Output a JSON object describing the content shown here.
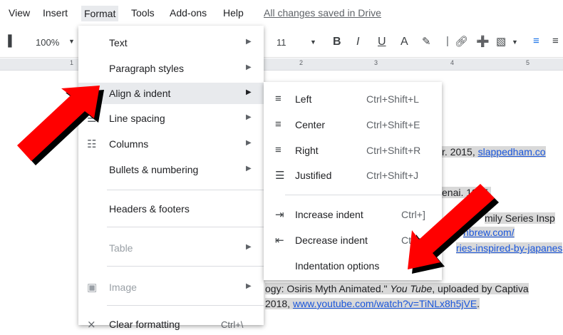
{
  "menubar": {
    "items": [
      "View",
      "Insert",
      "Format",
      "Tools",
      "Add-ons",
      "Help"
    ],
    "saved_status": "All changes saved in Drive"
  },
  "toolbar": {
    "zoom": "100%",
    "font_size": "11",
    "bold": "B",
    "italic": "I",
    "underline": "U",
    "text_color": "A"
  },
  "ruler": {
    "numbers": [
      "1",
      "2",
      "3",
      "4",
      "5"
    ]
  },
  "format_menu": {
    "items": [
      {
        "label": "Text"
      },
      {
        "label": "Paragraph styles"
      },
      {
        "label": "Align & indent"
      },
      {
        "label": "Line spacing"
      },
      {
        "label": "Columns"
      },
      {
        "label": "Bullets & numbering"
      },
      {
        "label": "Headers & footers"
      },
      {
        "label": "Table"
      },
      {
        "label": "Image"
      },
      {
        "label": "Clear formatting",
        "shortcut": "Ctrl+\\"
      }
    ]
  },
  "align_submenu": {
    "items": [
      {
        "label": "Left",
        "shortcut": "Ctrl+Shift+L"
      },
      {
        "label": "Center",
        "shortcut": "Ctrl+Shift+E"
      },
      {
        "label": "Right",
        "shortcut": "Ctrl+Shift+R"
      },
      {
        "label": "Justified",
        "shortcut": "Ctrl+Shift+J"
      },
      {
        "label": "Increase indent",
        "shortcut": "Ctrl+]"
      },
      {
        "label": "Decrease indent",
        "shortcut": "Ctrl+["
      },
      {
        "label": "Indentation options"
      }
    ]
  },
  "document": {
    "line1_text": "r. 2015, ",
    "line1_link": "slappedham.co",
    "line2_text": "enai. 1995.",
    "line3_text": "mily Series Insp",
    "line4_link": "nbrew.com/",
    "line5_link": "ries-inspired-by-japanes",
    "line6_text_a": "ogy: Osiris Myth Animated.\" ",
    "line6_italic": "You Tube",
    "line6_text_b": ", uploaded by Captiva",
    "line7_text": "2018, ",
    "line7_link": "www.youtube.com/watch?v=TiNLx8h5jVE",
    "line7_end": "."
  },
  "colors": {
    "arrow": "#ff0000",
    "accent": "#1a73e8"
  }
}
